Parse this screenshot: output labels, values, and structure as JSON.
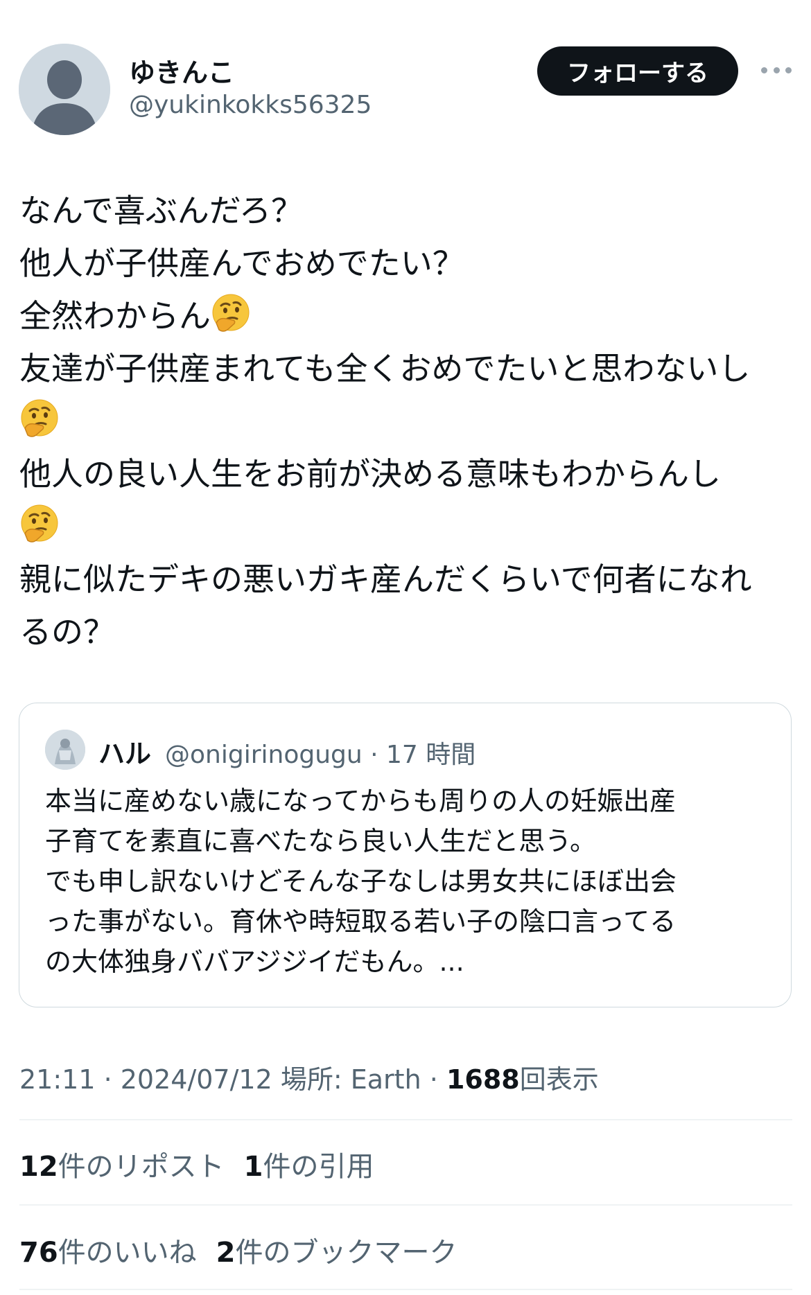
{
  "author": {
    "display_name": "ゆきんこ",
    "handle": "@yukinkokks56325",
    "avatar_icon": "default-profile-icon"
  },
  "follow_button": "フォローする",
  "more_icon": "more-horizontal-icon",
  "tweet": {
    "lines": [
      "なんで喜ぶんだろ？",
      "他人が子供産んでおめでたい？",
      "全然わからん",
      "友達が子供産まれても全くおめでたいと思わないし",
      "",
      "他人の良い人生をお前が決める意味もわからんし",
      "",
      "親に似たデキの悪いガキ産んだくらいで何者になれ",
      "るの？"
    ],
    "emoji": "thinking-face-icon"
  },
  "quote": {
    "display_name": "ハル",
    "handle_time": "@onigirinogugu · 17 時間",
    "lines": [
      "本当に産めない歳になってからも周りの人の妊娠出産",
      "子育てを素直に喜べたなら良い人生だと思う。",
      "でも申し訳ないけどそんな子なしは男女共にほぼ出会",
      "った事がない。育休や時短取る若い子の陰口言ってる",
      "の大体独身ババアジジイだもん。..."
    ]
  },
  "meta": {
    "time_date": "21:11 · 2024/07/12",
    "location": "場所: Earth",
    "sep": "·",
    "views_count": "1688",
    "views_label": "回表示"
  },
  "stats": {
    "reposts_count": "12",
    "reposts_label": "件のリポスト",
    "quotes_count": "1",
    "quotes_label": "件の引用",
    "likes_count": "76",
    "likes_label": "件のいいね",
    "bookmarks_count": "2",
    "bookmarks_label": "件のブックマーク"
  },
  "colors": {
    "text_primary": "#0f1419",
    "text_secondary": "#536471",
    "border": "#cfd9de",
    "button_bg": "#0f1419"
  }
}
